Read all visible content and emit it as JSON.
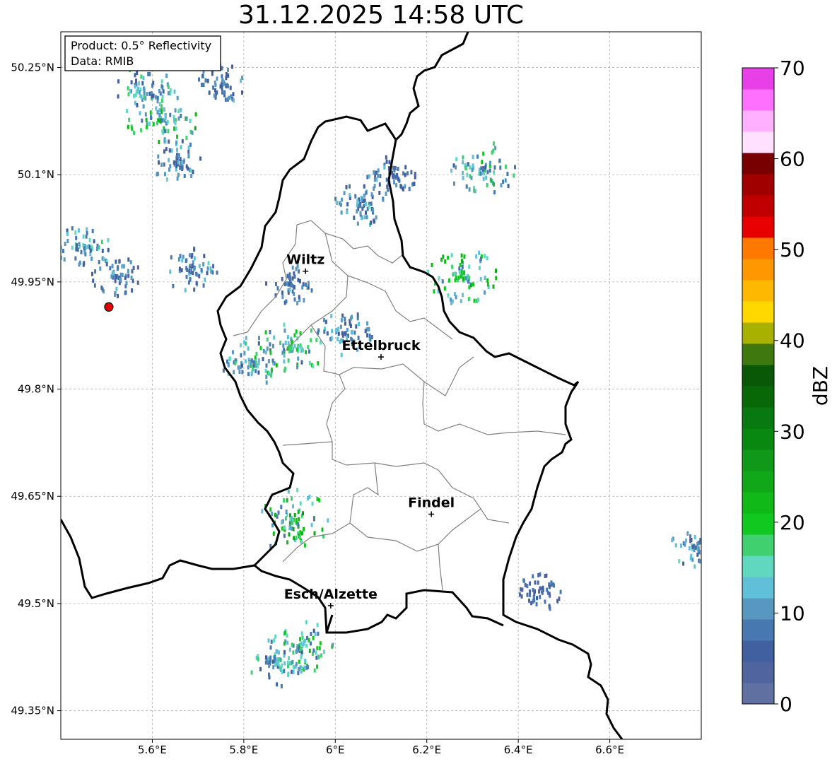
{
  "title": "31.12.2025 14:58 UTC",
  "info_box": {
    "product": "Product: 0.5° Reflectivity",
    "data": "Data: RMIB"
  },
  "map": {
    "lon_range": [
      5.4,
      6.8
    ],
    "lat_range": [
      49.31,
      50.3
    ],
    "lon_ticks": [
      5.6,
      5.8,
      6.0,
      6.2,
      6.4,
      6.6
    ],
    "lon_tick_labels": [
      "5.6°E",
      "5.8°E",
      "6°E",
      "6.2°E",
      "6.4°E",
      "6.6°E"
    ],
    "lat_ticks": [
      49.35,
      49.5,
      49.65,
      49.8,
      49.95,
      50.1,
      50.25
    ],
    "lat_tick_labels": [
      "49.35°N",
      "49.5°N",
      "49.65°N",
      "49.8°N",
      "49.95°N",
      "50.1°N",
      "50.25°N"
    ],
    "gridlines": true,
    "radar_site": {
      "lon": 5.505,
      "lat": 49.915
    },
    "cities": [
      {
        "name": "Wiltz",
        "lon": 5.935,
        "lat": 49.965
      },
      {
        "name": "Ettelbruck",
        "lon": 6.1,
        "lat": 49.845
      },
      {
        "name": "Findel",
        "lon": 6.21,
        "lat": 49.625
      },
      {
        "name": "Esch/Alzette",
        "lon": 5.99,
        "lat": 49.497
      }
    ]
  },
  "colorbar": {
    "label": "dBZ",
    "min": 0,
    "max": 70,
    "ticks": [
      0,
      10,
      20,
      30,
      40,
      50,
      60,
      70
    ],
    "tick_labels": [
      "0",
      "10",
      "20",
      "30",
      "40",
      "50",
      "60",
      "70"
    ],
    "colors": [
      "#6070a0",
      "#5064a0",
      "#4060a0",
      "#4878b0",
      "#5898c0",
      "#60c0d8",
      "#60d8c0",
      "#40d070",
      "#10c820",
      "#10b818",
      "#10a818",
      "#109818",
      "#088810",
      "#087810",
      "#086808",
      "#085808",
      "#407810",
      "#a8b000",
      "#ffd800",
      "#ffb800",
      "#ff9800",
      "#ff7800",
      "#e80000",
      "#c00000",
      "#a00000",
      "#780000",
      "#ffe0ff",
      "#ffb0ff",
      "#ff70ff",
      "#e840e8"
    ]
  },
  "echoes": [
    {
      "lon": 5.62,
      "lat": 50.18,
      "dbz": 20
    },
    {
      "lon": 5.58,
      "lat": 50.22,
      "dbz": 15
    },
    {
      "lon": 5.65,
      "lat": 50.12,
      "dbz": 12
    },
    {
      "lon": 5.45,
      "lat": 50.0,
      "dbz": 14
    },
    {
      "lon": 5.52,
      "lat": 49.96,
      "dbz": 10
    },
    {
      "lon": 5.68,
      "lat": 49.97,
      "dbz": 12
    },
    {
      "lon": 5.82,
      "lat": 49.84,
      "dbz": 16
    },
    {
      "lon": 5.9,
      "lat": 49.86,
      "dbz": 18
    },
    {
      "lon": 5.9,
      "lat": 49.95,
      "dbz": 10
    },
    {
      "lon": 6.02,
      "lat": 49.88,
      "dbz": 12
    },
    {
      "lon": 6.12,
      "lat": 50.1,
      "dbz": 10
    },
    {
      "lon": 6.05,
      "lat": 50.06,
      "dbz": 12
    },
    {
      "lon": 6.28,
      "lat": 49.96,
      "dbz": 20
    },
    {
      "lon": 6.32,
      "lat": 50.11,
      "dbz": 18
    },
    {
      "lon": 5.75,
      "lat": 50.23,
      "dbz": 10
    },
    {
      "lon": 5.92,
      "lat": 49.44,
      "dbz": 18
    },
    {
      "lon": 5.87,
      "lat": 49.42,
      "dbz": 14
    },
    {
      "lon": 5.9,
      "lat": 49.62,
      "dbz": 22
    },
    {
      "lon": 6.45,
      "lat": 49.52,
      "dbz": 8
    },
    {
      "lon": 6.79,
      "lat": 49.58,
      "dbz": 12
    }
  ]
}
